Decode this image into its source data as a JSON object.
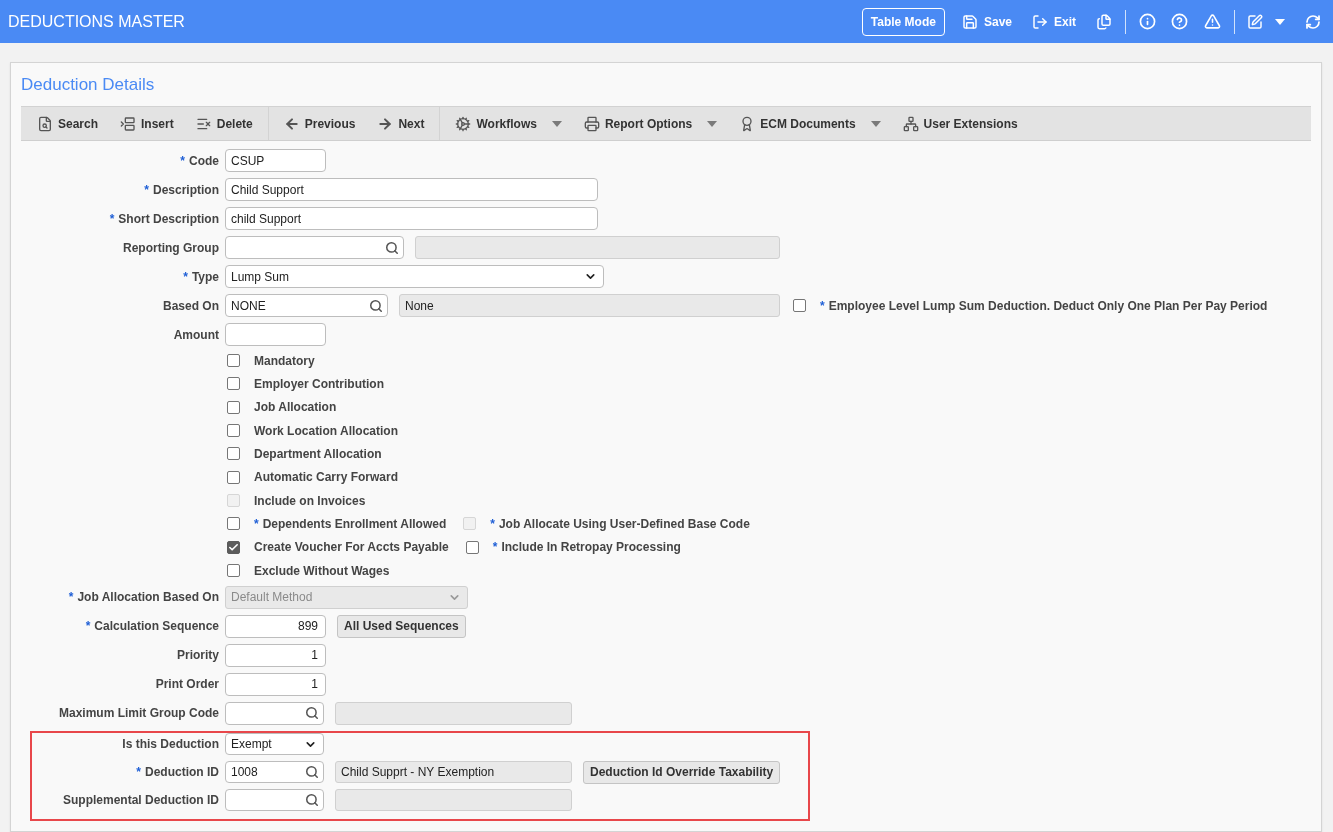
{
  "app_bar": {
    "title": "DEDUCTIONS MASTER",
    "table_mode_button": "Table Mode",
    "actions": [
      "Save",
      "Exit"
    ]
  },
  "panel": {
    "title": "Deduction Details",
    "toolbar": {
      "groups": [
        {
          "items": [
            {
              "label": "Search",
              "has_menu": false
            },
            {
              "label": "Insert",
              "has_menu": false
            },
            {
              "label": "Delete",
              "has_menu": false
            }
          ]
        },
        {
          "items": [
            {
              "label": "Previous",
              "has_menu": false
            },
            {
              "label": "Next",
              "has_menu": false
            }
          ]
        },
        {
          "items": [
            {
              "label": "Workflows",
              "has_menu": true
            },
            {
              "label": "Report Options",
              "has_menu": true
            },
            {
              "label": "ECM Documents",
              "has_menu": true
            },
            {
              "label": "User Extensions",
              "has_menu": false
            }
          ]
        }
      ]
    },
    "fields": [
      {
        "kind": "text",
        "required_mark": "*",
        "label": "Code",
        "value": "CSUP"
      },
      {
        "kind": "text",
        "required_mark": "*",
        "label": "Description",
        "value": "Child Support"
      },
      {
        "kind": "text",
        "required_mark": "*",
        "label": "Short Description",
        "value": "child Support"
      },
      {
        "kind": "lookup",
        "label": "Reporting Group",
        "description_field": {
          "readonly": true
        }
      },
      {
        "kind": "select",
        "required_mark": "*",
        "label": "Type",
        "value": "Lump Sum",
        "disabled": false
      },
      {
        "kind": "lookup",
        "label": "Based On",
        "value": "NONE",
        "description_field": {
          "readonly": true,
          "value": "None"
        },
        "option": {
          "checked": false,
          "disabled": false,
          "required_mark": "*",
          "label": "Employee Level Lump Sum Deduction. Deduct Only One Plan Per Pay Period"
        }
      },
      {
        "kind": "text",
        "label": "Amount"
      }
    ],
    "checkbox_rows": [
      {
        "items": [
          {
            "label": "Mandatory",
            "checked": false,
            "disabled": false
          }
        ]
      },
      {
        "items": [
          {
            "label": "Employer Contribution",
            "checked": false,
            "disabled": false
          }
        ]
      },
      {
        "items": [
          {
            "label": "Job Allocation",
            "checked": false,
            "disabled": false
          }
        ]
      },
      {
        "items": [
          {
            "label": "Work Location Allocation",
            "checked": false,
            "disabled": false
          }
        ]
      },
      {
        "items": [
          {
            "label": "Department Allocation",
            "checked": false,
            "disabled": false
          }
        ]
      },
      {
        "items": [
          {
            "label": "Automatic Carry Forward",
            "checked": false,
            "disabled": false
          }
        ]
      },
      {
        "items": [
          {
            "label": "Include on Invoices",
            "checked": false,
            "disabled": true
          }
        ]
      },
      {
        "items": [
          {
            "required_mark": "*",
            "label": "Dependents Enrollment Allowed",
            "checked": false,
            "disabled": false
          },
          {
            "required_mark": "*",
            "label": "Job Allocate Using User-Defined Base Code",
            "checked": false,
            "disabled": true
          }
        ]
      },
      {
        "items": [
          {
            "label": "Create Voucher For Accts Payable",
            "checked": true,
            "disabled": false
          },
          {
            "required_mark": "*",
            "label": "Include In Retropay Processing",
            "checked": false,
            "disabled": false
          }
        ]
      },
      {
        "items": [
          {
            "label": "Exclude Without Wages",
            "checked": false,
            "disabled": false
          }
        ]
      }
    ],
    "settings": [
      {
        "kind": "select",
        "required_mark": "*",
        "label": "Job Allocation Based On",
        "value": "Default Method",
        "disabled": true
      },
      {
        "kind": "number",
        "required_mark": "*",
        "label": "Calculation Sequence",
        "value": "899",
        "button": "All Used Sequences"
      },
      {
        "kind": "number",
        "label": "Priority",
        "value": "1"
      },
      {
        "kind": "number",
        "label": "Print Order",
        "value": "1"
      },
      {
        "kind": "lookup",
        "label": "Maximum Limit Group Code",
        "description_field": {
          "readonly": true
        }
      }
    ],
    "highlighted_section": {
      "highlighted": true,
      "fields": [
        {
          "kind": "select",
          "label": "Is this Deduction",
          "value": "Exempt",
          "disabled": false
        },
        {
          "kind": "lookup",
          "required_mark": "*",
          "label": "Deduction ID",
          "value": "1008",
          "description_field": {
            "readonly": true,
            "value": "Child Supprt - NY Exemption"
          },
          "button": "Deduction Id Override Taxability"
        },
        {
          "kind": "lookup",
          "label": "Supplemental Deduction ID",
          "description_field": {
            "readonly": true
          }
        }
      ]
    }
  }
}
